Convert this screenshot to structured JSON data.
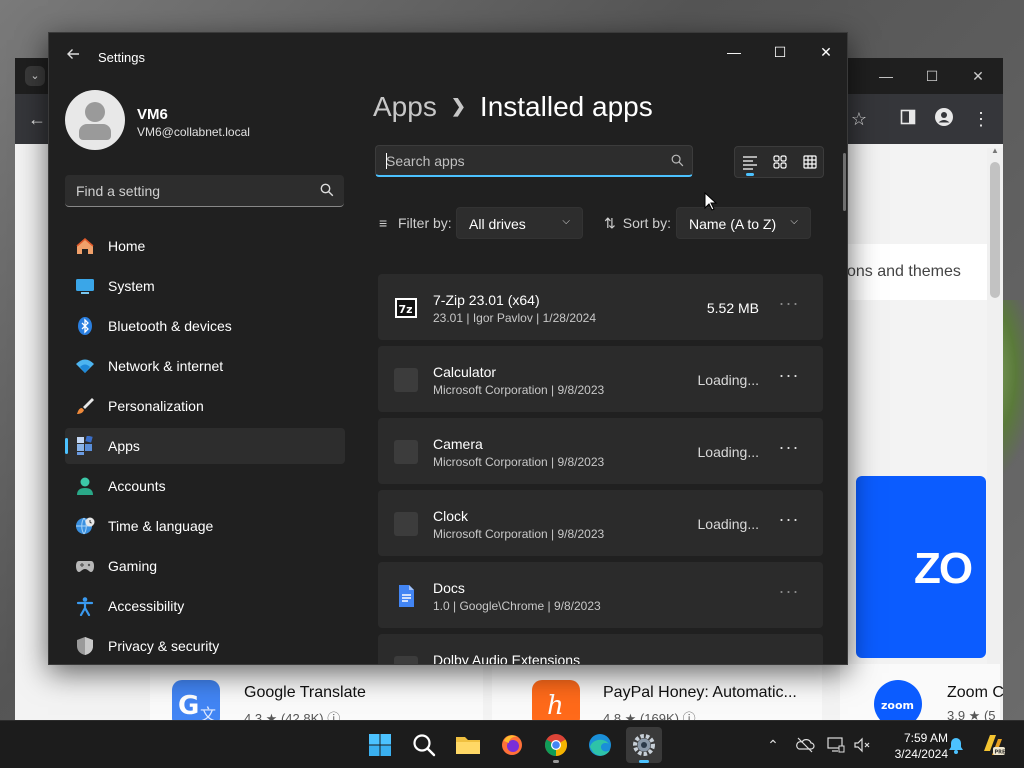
{
  "settings": {
    "title": "Settings",
    "profile": {
      "name": "VM6",
      "email": "VM6@collabnet.local"
    },
    "find_placeholder": "Find a setting",
    "nav": [
      {
        "label": "Home",
        "icon": "home-icon"
      },
      {
        "label": "System",
        "icon": "system-icon"
      },
      {
        "label": "Bluetooth & devices",
        "icon": "bluetooth-icon"
      },
      {
        "label": "Network & internet",
        "icon": "wifi-icon"
      },
      {
        "label": "Personalization",
        "icon": "brush-icon"
      },
      {
        "label": "Apps",
        "icon": "apps-icon",
        "selected": true
      },
      {
        "label": "Accounts",
        "icon": "accounts-icon"
      },
      {
        "label": "Time & language",
        "icon": "globe-clock-icon"
      },
      {
        "label": "Gaming",
        "icon": "gamepad-icon"
      },
      {
        "label": "Accessibility",
        "icon": "accessibility-icon"
      },
      {
        "label": "Privacy & security",
        "icon": "shield-icon"
      }
    ],
    "breadcrumb": {
      "root": "Apps",
      "current": "Installed apps"
    },
    "search_placeholder": "Search apps",
    "filter": {
      "label": "Filter by:",
      "value": "All drives"
    },
    "sort": {
      "label": "Sort by:",
      "value": "Name (A to Z)"
    },
    "apps": [
      {
        "name": "7-Zip 23.01 (x64)",
        "meta": "23.01  |  Igor Pavlov  |  1/28/2024",
        "size": "5.52 MB",
        "icon": "7zip-icon"
      },
      {
        "name": "Calculator",
        "meta": "Microsoft Corporation  |  9/8/2023",
        "size": "Loading...",
        "icon": "calculator-icon"
      },
      {
        "name": "Camera",
        "meta": "Microsoft Corporation  |  9/8/2023",
        "size": "Loading...",
        "icon": "camera-icon"
      },
      {
        "name": "Clock",
        "meta": "Microsoft Corporation  |  9/8/2023",
        "size": "Loading...",
        "icon": "clock-icon"
      },
      {
        "name": "Docs",
        "meta": "1.0  |  Google\\Chrome  |  9/8/2023",
        "size": "",
        "icon": "docs-icon"
      },
      {
        "name": "Dolby Audio Extensions",
        "meta": "",
        "size": "",
        "icon": "dolby-icon"
      }
    ]
  },
  "chrome_bg": {
    "partial_text": "ons and themes",
    "zoom_banner_text": "ZO",
    "bottom_apps": [
      {
        "name": "Google Translate",
        "rating": "4.3 ★ (42.8K) ⓘ"
      },
      {
        "name": "PayPal Honey: Automatic...",
        "rating": "4.8 ★ (169K) ⓘ"
      },
      {
        "name": "Zoom C",
        "rating": "3.9 ★ (5"
      }
    ]
  },
  "taskbar": {
    "time": "7:59 AM",
    "date": "3/24/2024"
  },
  "colors": {
    "accent": "#4cc2ff",
    "window_bg": "#202020",
    "card_bg": "#2b2b2b"
  }
}
